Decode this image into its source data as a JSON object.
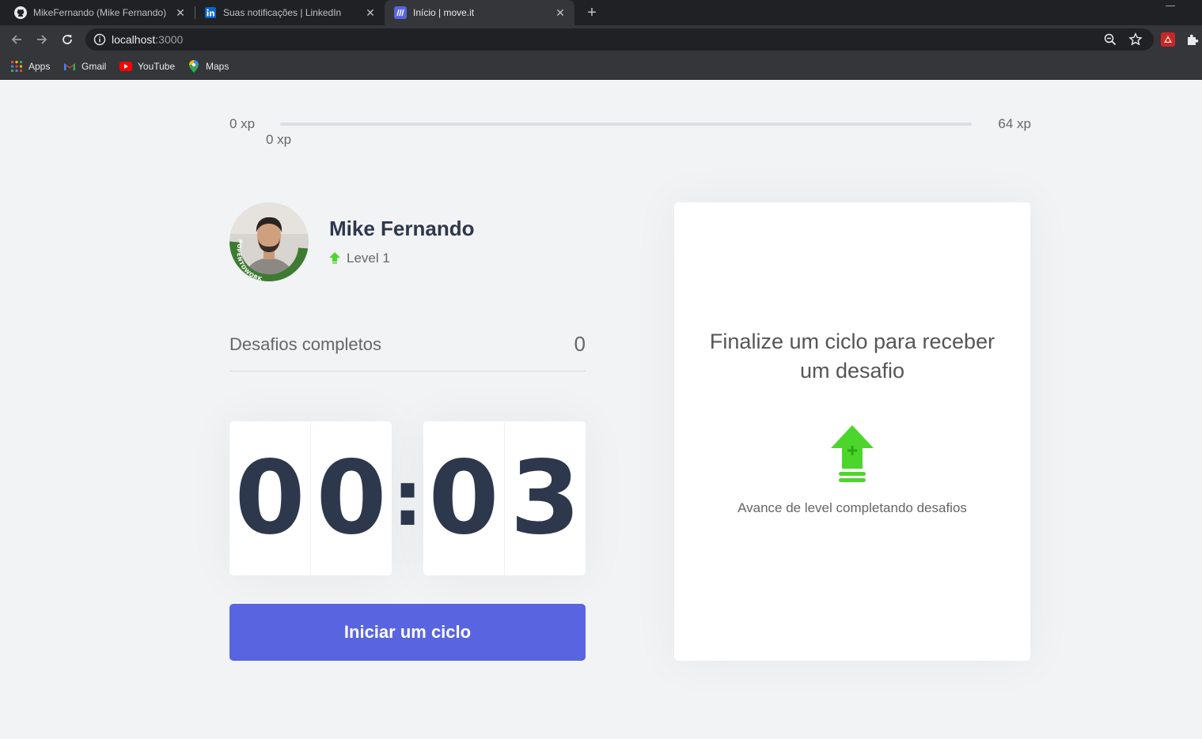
{
  "browser": {
    "tabs": [
      {
        "title": "MikeFernando (Mike Fernando)",
        "icon": "github-icon",
        "active": false
      },
      {
        "title": "Suas notificações | LinkedIn",
        "icon": "linkedin-icon",
        "active": false
      },
      {
        "title": "Início | move.it",
        "icon": "moveit-icon",
        "active": true
      }
    ],
    "url_host": "localhost",
    "url_port": ":3000",
    "bookmarks": [
      {
        "label": "Apps",
        "icon": "apps-grid-icon"
      },
      {
        "label": "Gmail",
        "icon": "gmail-icon"
      },
      {
        "label": "YouTube",
        "icon": "youtube-icon"
      },
      {
        "label": "Maps",
        "icon": "maps-icon"
      }
    ]
  },
  "experience": {
    "min_label": "0 xp",
    "max_label": "64 xp",
    "current_label": "0 xp",
    "progress_fraction": 0
  },
  "profile": {
    "name": "Mike Fernando",
    "level": "Level 1",
    "avatar_badge": "#OPENTOWORK"
  },
  "completed": {
    "label": "Desafios completos",
    "count": "0"
  },
  "countdown": {
    "minute_left": "0",
    "minute_right": "0",
    "colon": ":",
    "second_left": "0",
    "second_right": "3"
  },
  "actions": {
    "start_label": "Iniciar um ciclo"
  },
  "challenge_box": {
    "title": "Finalize um ciclo para receber um desafio",
    "description": "Avance de level completando desafios"
  },
  "colors": {
    "accent": "#5965e0",
    "green": "#4cd62b",
    "title": "#2e384d",
    "text": "#666666",
    "background": "#f2f3f5"
  }
}
